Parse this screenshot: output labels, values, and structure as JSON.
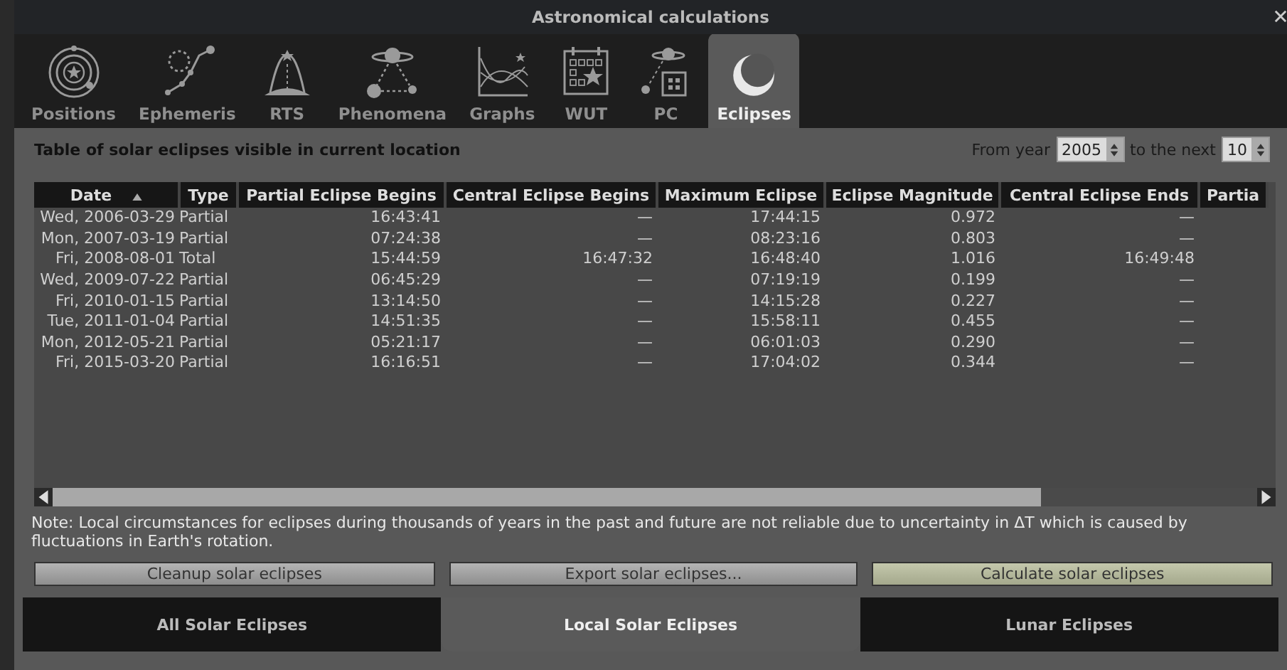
{
  "window": {
    "title": "Astronomical calculations"
  },
  "tabs": [
    {
      "label": "Positions",
      "kind": "positions",
      "selected": false
    },
    {
      "label": "Ephemeris",
      "kind": "ephemeris",
      "selected": false
    },
    {
      "label": "RTS",
      "kind": "rts",
      "selected": false
    },
    {
      "label": "Phenomena",
      "kind": "phenomena",
      "selected": false
    },
    {
      "label": "Graphs",
      "kind": "graphs",
      "selected": false
    },
    {
      "label": "WUT",
      "kind": "wut",
      "selected": false
    },
    {
      "label": "PC",
      "kind": "pc",
      "selected": false
    },
    {
      "label": "Eclipses",
      "kind": "eclipses",
      "selected": true
    }
  ],
  "heading": "Table of solar eclipses visible in current location",
  "range": {
    "from_label": "From year",
    "from_value": "2005",
    "next_label": "to the next",
    "next_value": "10"
  },
  "table": {
    "columns": [
      {
        "label": "Date",
        "sorted": true
      },
      {
        "label": "Type",
        "sorted": false
      },
      {
        "label": "Partial Eclipse Begins",
        "sorted": false
      },
      {
        "label": "Central Eclipse Begins",
        "sorted": false
      },
      {
        "label": "Maximum Eclipse",
        "sorted": false
      },
      {
        "label": "Eclipse Magnitude",
        "sorted": false
      },
      {
        "label": "Central Eclipse Ends",
        "sorted": false
      },
      {
        "label": "Partia",
        "sorted": false
      }
    ],
    "rows": [
      [
        "Wed, 2006-03-29",
        "Partial",
        "16:43:41",
        "—",
        "17:44:15",
        "0.972",
        "—"
      ],
      [
        "Mon, 2007-03-19",
        "Partial",
        "07:24:38",
        "—",
        "08:23:16",
        "0.803",
        "—"
      ],
      [
        "Fri, 2008-08-01",
        "Total",
        "15:44:59",
        "16:47:32",
        "16:48:40",
        "1.016",
        "16:49:48"
      ],
      [
        "Wed, 2009-07-22",
        "Partial",
        "06:45:29",
        "—",
        "07:19:19",
        "0.199",
        "—"
      ],
      [
        "Fri, 2010-01-15",
        "Partial",
        "13:14:50",
        "—",
        "14:15:28",
        "0.227",
        "—"
      ],
      [
        "Tue, 2011-01-04",
        "Partial",
        "14:51:35",
        "—",
        "15:58:11",
        "0.455",
        "—"
      ],
      [
        "Mon, 2012-05-21",
        "Partial",
        "05:21:17",
        "—",
        "06:01:03",
        "0.290",
        "—"
      ],
      [
        "Fri, 2015-03-20",
        "Partial",
        "16:16:51",
        "—",
        "17:04:02",
        "0.344",
        "—"
      ]
    ]
  },
  "note": "Note: Local circumstances for eclipses during thousands of years in the past and future are not reliable due to uncertainty in ΔT which is caused by fluctuations in Earth's rotation.",
  "buttons": [
    {
      "label": "Cleanup solar eclipses",
      "highlighted": false
    },
    {
      "label": "Export solar eclipses...",
      "highlighted": false
    },
    {
      "label": "Calculate solar eclipses",
      "highlighted": true
    }
  ],
  "bottom_tabs": [
    {
      "label": "All Solar Eclipses",
      "selected": false
    },
    {
      "label": "Local Solar Eclipses",
      "selected": true
    },
    {
      "label": "Lunar Eclipses",
      "selected": false
    }
  ]
}
